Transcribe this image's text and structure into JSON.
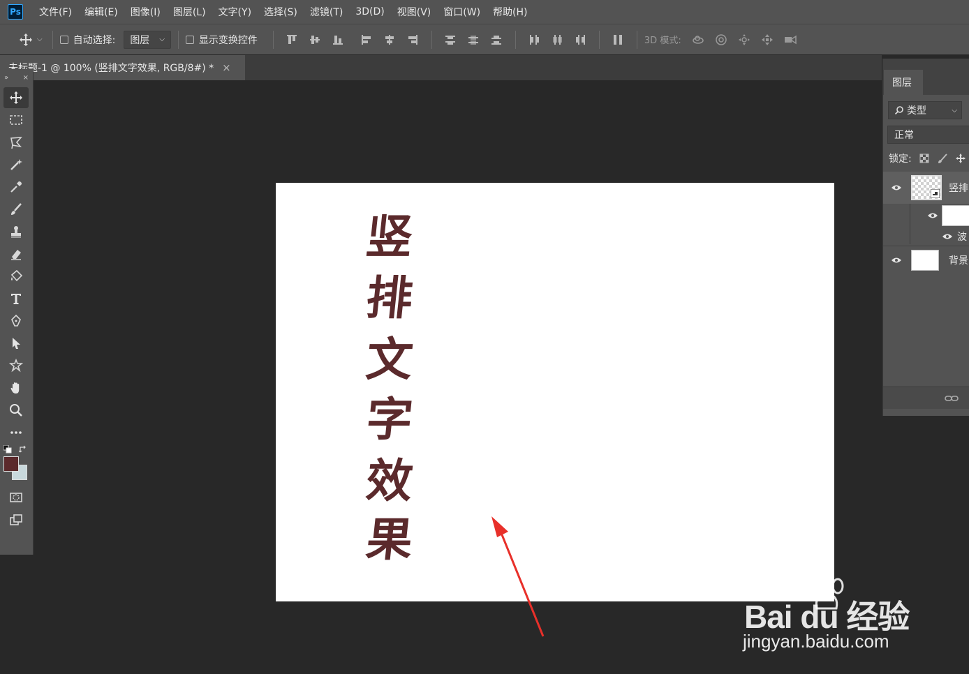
{
  "app": {
    "logo": "Ps"
  },
  "menu": [
    "文件(F)",
    "编辑(E)",
    "图像(I)",
    "图层(L)",
    "文字(Y)",
    "选择(S)",
    "滤镜(T)",
    "3D(D)",
    "视图(V)",
    "窗口(W)",
    "帮助(H)"
  ],
  "options": {
    "auto_select_label": "自动选择:",
    "auto_select_target": "图层",
    "show_transform_label": "显示变换控件",
    "mode_3d_label": "3D 模式:"
  },
  "document": {
    "tab_title": "未标题-1 @ 100% (竖排文字效果, RGB/8#) *",
    "close": "×",
    "glyphs": [
      "竖",
      "排",
      "文",
      "字",
      "效",
      "果"
    ]
  },
  "toolbar": {
    "collapse": "»",
    "close": "×",
    "foreground_color": "#5b2a2c",
    "background_color": "#c8d8dc"
  },
  "layers_panel": {
    "tab_label": "图层",
    "filter_label": "类型",
    "blend_mode": "正常",
    "lock_label": "锁定:",
    "layers": [
      {
        "name": "竖排"
      },
      {
        "name": ""
      },
      {
        "name": "波"
      },
      {
        "name": "背景"
      }
    ]
  },
  "watermark": {
    "brand": "Bai du 经验",
    "url": "jingyan.baidu.com"
  },
  "colors": {
    "accent": "#31a8ff",
    "annotation": "#e8302a"
  }
}
